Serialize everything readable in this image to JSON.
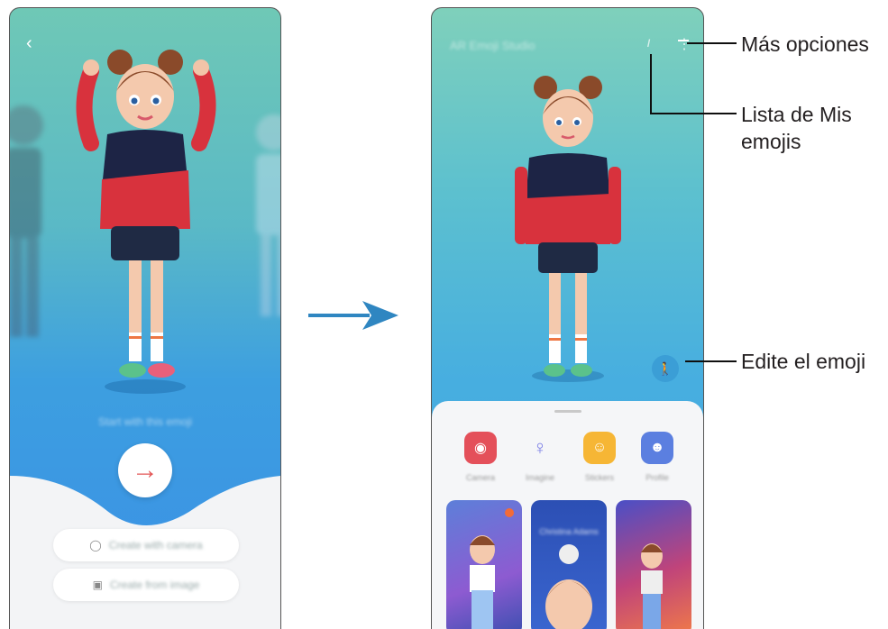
{
  "screen1": {
    "prompt_text": "Start with this emoji",
    "create_camera_label": "Create with camera",
    "create_image_label": "Create from image"
  },
  "screen2": {
    "title": "AR Emoji Studio",
    "tiles": [
      {
        "label": "Camera",
        "color": "#e4505a"
      },
      {
        "label": "Imagine",
        "color": "#7b7fe6"
      },
      {
        "label": "Stickers",
        "color": "#f6b635"
      },
      {
        "label": "Profile",
        "color": "#5b7fe0"
      }
    ],
    "card_text": "Christina Adams"
  },
  "callouts": {
    "more_options": "Más opciones",
    "my_emojis_list": "Lista de Mis\nemojis",
    "edit_emoji": "Edite el emoji"
  },
  "colors": {
    "arrow": "#2f86c1",
    "accent_red": "#e35757",
    "sweater_navy": "#1d2445",
    "sweater_red": "#d8323d"
  }
}
